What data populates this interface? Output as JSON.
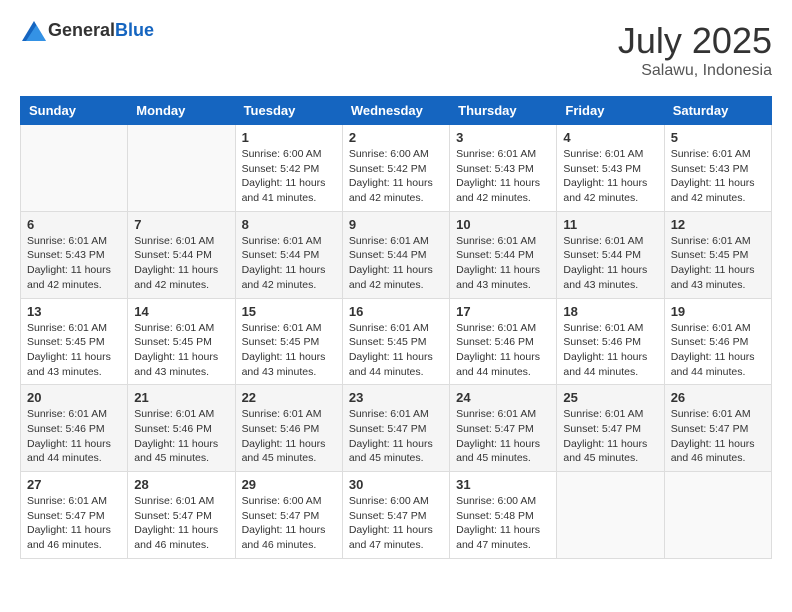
{
  "header": {
    "logo_general": "General",
    "logo_blue": "Blue",
    "month": "July 2025",
    "location": "Salawu, Indonesia"
  },
  "columns": [
    "Sunday",
    "Monday",
    "Tuesday",
    "Wednesday",
    "Thursday",
    "Friday",
    "Saturday"
  ],
  "weeks": [
    [
      {
        "day": "",
        "info": ""
      },
      {
        "day": "",
        "info": ""
      },
      {
        "day": "1",
        "info": "Sunrise: 6:00 AM\nSunset: 5:42 PM\nDaylight: 11 hours and 41 minutes."
      },
      {
        "day": "2",
        "info": "Sunrise: 6:00 AM\nSunset: 5:42 PM\nDaylight: 11 hours and 42 minutes."
      },
      {
        "day": "3",
        "info": "Sunrise: 6:01 AM\nSunset: 5:43 PM\nDaylight: 11 hours and 42 minutes."
      },
      {
        "day": "4",
        "info": "Sunrise: 6:01 AM\nSunset: 5:43 PM\nDaylight: 11 hours and 42 minutes."
      },
      {
        "day": "5",
        "info": "Sunrise: 6:01 AM\nSunset: 5:43 PM\nDaylight: 11 hours and 42 minutes."
      }
    ],
    [
      {
        "day": "6",
        "info": "Sunrise: 6:01 AM\nSunset: 5:43 PM\nDaylight: 11 hours and 42 minutes."
      },
      {
        "day": "7",
        "info": "Sunrise: 6:01 AM\nSunset: 5:44 PM\nDaylight: 11 hours and 42 minutes."
      },
      {
        "day": "8",
        "info": "Sunrise: 6:01 AM\nSunset: 5:44 PM\nDaylight: 11 hours and 42 minutes."
      },
      {
        "day": "9",
        "info": "Sunrise: 6:01 AM\nSunset: 5:44 PM\nDaylight: 11 hours and 42 minutes."
      },
      {
        "day": "10",
        "info": "Sunrise: 6:01 AM\nSunset: 5:44 PM\nDaylight: 11 hours and 43 minutes."
      },
      {
        "day": "11",
        "info": "Sunrise: 6:01 AM\nSunset: 5:44 PM\nDaylight: 11 hours and 43 minutes."
      },
      {
        "day": "12",
        "info": "Sunrise: 6:01 AM\nSunset: 5:45 PM\nDaylight: 11 hours and 43 minutes."
      }
    ],
    [
      {
        "day": "13",
        "info": "Sunrise: 6:01 AM\nSunset: 5:45 PM\nDaylight: 11 hours and 43 minutes."
      },
      {
        "day": "14",
        "info": "Sunrise: 6:01 AM\nSunset: 5:45 PM\nDaylight: 11 hours and 43 minutes."
      },
      {
        "day": "15",
        "info": "Sunrise: 6:01 AM\nSunset: 5:45 PM\nDaylight: 11 hours and 43 minutes."
      },
      {
        "day": "16",
        "info": "Sunrise: 6:01 AM\nSunset: 5:45 PM\nDaylight: 11 hours and 44 minutes."
      },
      {
        "day": "17",
        "info": "Sunrise: 6:01 AM\nSunset: 5:46 PM\nDaylight: 11 hours and 44 minutes."
      },
      {
        "day": "18",
        "info": "Sunrise: 6:01 AM\nSunset: 5:46 PM\nDaylight: 11 hours and 44 minutes."
      },
      {
        "day": "19",
        "info": "Sunrise: 6:01 AM\nSunset: 5:46 PM\nDaylight: 11 hours and 44 minutes."
      }
    ],
    [
      {
        "day": "20",
        "info": "Sunrise: 6:01 AM\nSunset: 5:46 PM\nDaylight: 11 hours and 44 minutes."
      },
      {
        "day": "21",
        "info": "Sunrise: 6:01 AM\nSunset: 5:46 PM\nDaylight: 11 hours and 45 minutes."
      },
      {
        "day": "22",
        "info": "Sunrise: 6:01 AM\nSunset: 5:46 PM\nDaylight: 11 hours and 45 minutes."
      },
      {
        "day": "23",
        "info": "Sunrise: 6:01 AM\nSunset: 5:47 PM\nDaylight: 11 hours and 45 minutes."
      },
      {
        "day": "24",
        "info": "Sunrise: 6:01 AM\nSunset: 5:47 PM\nDaylight: 11 hours and 45 minutes."
      },
      {
        "day": "25",
        "info": "Sunrise: 6:01 AM\nSunset: 5:47 PM\nDaylight: 11 hours and 45 minutes."
      },
      {
        "day": "26",
        "info": "Sunrise: 6:01 AM\nSunset: 5:47 PM\nDaylight: 11 hours and 46 minutes."
      }
    ],
    [
      {
        "day": "27",
        "info": "Sunrise: 6:01 AM\nSunset: 5:47 PM\nDaylight: 11 hours and 46 minutes."
      },
      {
        "day": "28",
        "info": "Sunrise: 6:01 AM\nSunset: 5:47 PM\nDaylight: 11 hours and 46 minutes."
      },
      {
        "day": "29",
        "info": "Sunrise: 6:00 AM\nSunset: 5:47 PM\nDaylight: 11 hours and 46 minutes."
      },
      {
        "day": "30",
        "info": "Sunrise: 6:00 AM\nSunset: 5:47 PM\nDaylight: 11 hours and 47 minutes."
      },
      {
        "day": "31",
        "info": "Sunrise: 6:00 AM\nSunset: 5:48 PM\nDaylight: 11 hours and 47 minutes."
      },
      {
        "day": "",
        "info": ""
      },
      {
        "day": "",
        "info": ""
      }
    ]
  ]
}
